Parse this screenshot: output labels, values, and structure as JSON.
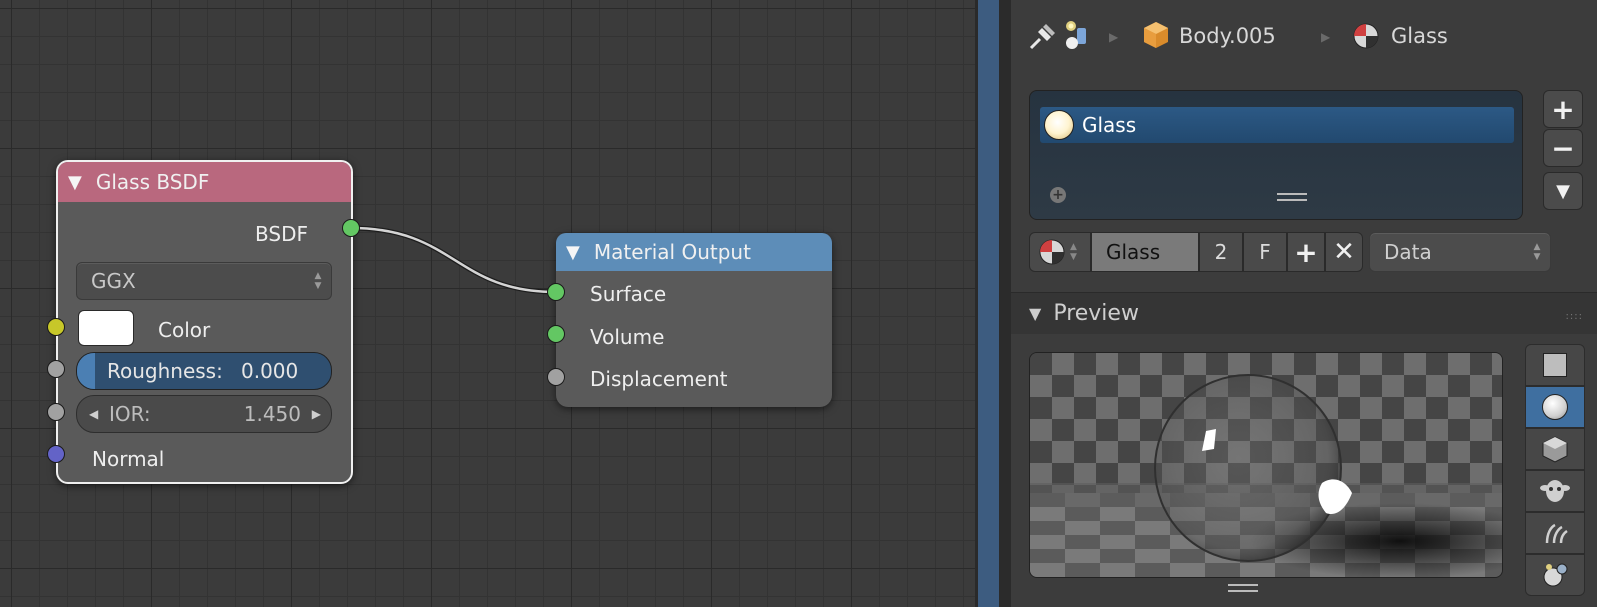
{
  "node_editor": {
    "glass_node": {
      "title": "Glass BSDF",
      "output_label": "BSDF",
      "distribution": "GGX",
      "color_label": "Color",
      "roughness_label": "Roughness:",
      "roughness_value": "0.000",
      "ior_label": "IOR:",
      "ior_value": "1.450",
      "normal_label": "Normal",
      "colors": {
        "header": "#b9687e",
        "socket_bsdf": "#63c763",
        "socket_color": "#c7c729",
        "socket_value": "#a1a1a1",
        "socket_vector": "#6363c7"
      }
    },
    "output_node": {
      "title": "Material Output",
      "inputs": [
        "Surface",
        "Volume",
        "Displacement"
      ],
      "colors": {
        "header": "#5d8db8"
      }
    }
  },
  "properties": {
    "breadcrumb": {
      "object": "Body.005",
      "material": "Glass",
      "icons": [
        "pin-icon",
        "scene-data-icon",
        "object-cube-icon",
        "material-icon"
      ]
    },
    "material_slots": {
      "items": [
        "Glass"
      ],
      "side_buttons": [
        "+",
        "−",
        "▼"
      ]
    },
    "material_selector": {
      "name": "Glass",
      "users": "2",
      "fake_user": "F",
      "link_mode": "Data"
    },
    "preview_panel": {
      "title": "Preview",
      "shapes": [
        "flat-plane-icon",
        "sphere-icon",
        "cube-icon",
        "monkey-icon",
        "hair-icon",
        "sphere-bg-icon"
      ],
      "active_shape": "sphere-icon"
    }
  }
}
